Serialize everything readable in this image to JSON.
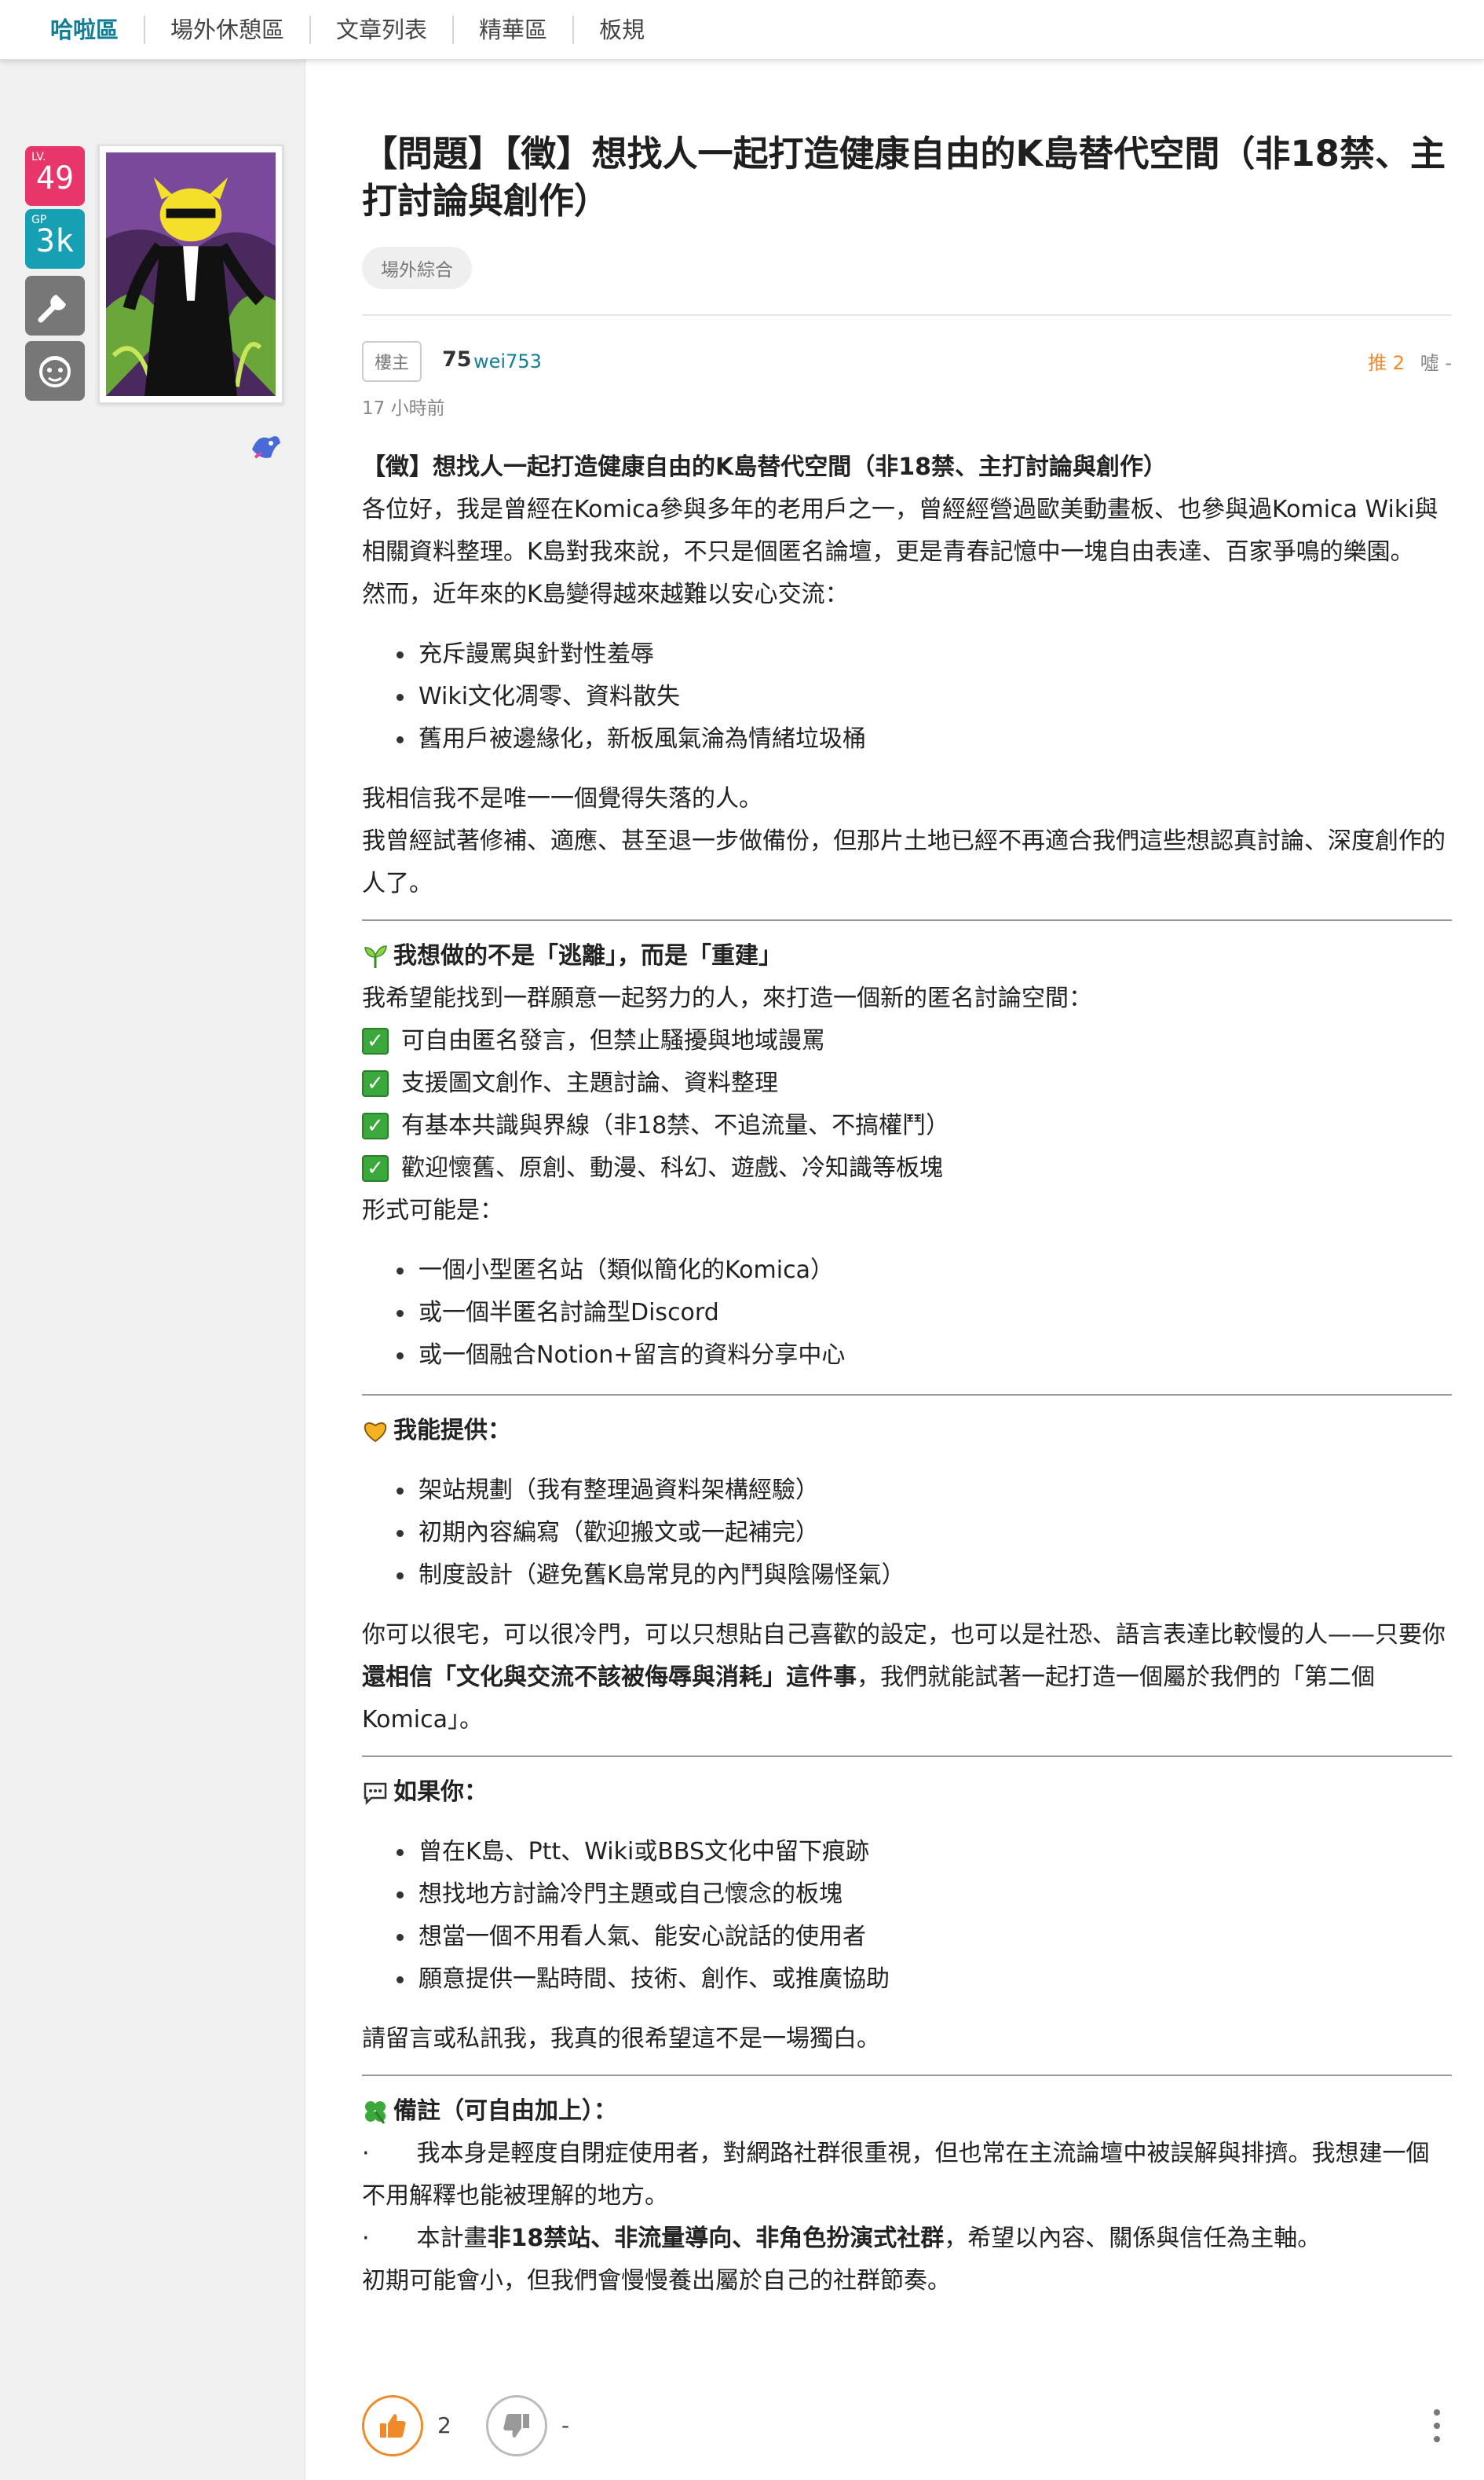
{
  "nav": {
    "items": [
      "哈啦區",
      "場外休憩區",
      "文章列表",
      "精華區",
      "板規"
    ]
  },
  "user_badges": {
    "lv_label": "LV.",
    "lv_value": "49",
    "gp_label": "GP",
    "gp_value": "3k"
  },
  "post": {
    "title": "【問題】【徵】想找人一起打造健康自由的K島替代空間（非18禁、主打討論與創作）",
    "tag": "場外綜合",
    "author_tag": "樓主",
    "author_level": "75",
    "author_id": "wei753",
    "push": "推 2",
    "boo": "噓 -",
    "time": "17 小時前",
    "body": {
      "heading": "【徵】想找人一起打造健康自由的K島替代空間（非18禁、主打討論與創作）",
      "intro": "各位好，我是曾經在Komica參與多年的老用戶之一，曾經經營過歐美動畫板、也參與過Komica Wiki與相關資料整理。K島對我來說，不只是個匿名論壇，更是青春記憶中一塊自由表達、百家爭鳴的樂園。",
      "however": "然而，近年來的K島變得越來越難以安心交流：",
      "problems": [
        "充斥謾罵與針對性羞辱",
        "Wiki文化凋零、資料散失",
        "舊用戶被邊緣化，新板風氣淪為情緒垃圾桶"
      ],
      "not_alone": "我相信我不是唯一一個覺得失落的人。",
      "tried": "我曾經試著修補、適應、甚至退一步做備份，但那片土地已經不再適合我們這些想認真討論、深度創作的人了。",
      "sec1_title": "我想做的不是「逃離」，而是「重建」",
      "sec1_intro": "我希望能找到一群願意一起努力的人，來打造一個新的匿名討論空間：",
      "checks": [
        "可自由匿名發言，但禁止騷擾與地域謾罵",
        "支援圖文創作、主題討論、資料整理",
        "有基本共識與界線（非18禁、不追流量、不搞權鬥）",
        "歡迎懷舊、原創、動漫、科幻、遊戲、冷知識等板塊"
      ],
      "forms_label": "形式可能是：",
      "forms": [
        "一個小型匿名站（類似簡化的Komica）",
        "或一個半匿名討論型Discord",
        "或一個融合Notion+留言的資料分享中心"
      ],
      "sec2_title": "我能提供：",
      "offers": [
        "架站規劃（我有整理過資料架構經驗）",
        "初期內容編寫（歡迎搬文或一起補完）",
        "制度設計（避免舊K島常見的內鬥與陰陽怪氣）"
      ],
      "para_a": "你可以很宅，可以很冷門，可以只想貼自己喜歡的設定，也可以是社恐、語言表達比較慢的人——只要你",
      "para_bold": "還相信「文化與交流不該被侮辱與消耗」這件事",
      "para_b": "，我們就能試著一起打造一個屬於我們的「第二個Komica」。",
      "sec3_title": "如果你：",
      "ifs": [
        "曾在K島、Ptt、Wiki或BBS文化中留下痕跡",
        "想找地方討論冷門主題或自己懷念的板塊",
        "想當一個不用看人氣、能安心說話的使用者",
        "願意提供一點時間、技術、創作、或推廣協助"
      ],
      "closing": "請留言或私訊我，我真的很希望這不是一場獨白。",
      "sec4_title": "備註（可自由加上）：",
      "note1": "·　　我本身是輕度自閉症使用者，對網路社群很重視，但也常在主流論壇中被誤解與排擠。我想建一個不用解釋也能被理解的地方。",
      "note2_a": "·　　本計畫",
      "note2_bold": "非18禁站、非流量導向、非角色扮演式社群",
      "note2_b": "，希望以內容、關係與信任為主軸。",
      "note3": "初期可能會小，但我們會慢慢養出屬於自己的社群節奏。"
    },
    "like_count": "2",
    "dislike_count": "-"
  },
  "colors": {
    "accent": "#117e96",
    "push": "#f0892a",
    "lv_badge": "#e8356a",
    "gp_badge": "#17a0b3",
    "check": "#3aa83a"
  },
  "icons": [
    "wrench-icon",
    "face-icon",
    "seedling-icon",
    "heart-hands-icon",
    "speech-bubble-icon",
    "clover-icon",
    "thumbs-up-icon",
    "thumbs-down-icon",
    "more-vertical-icon"
  ]
}
